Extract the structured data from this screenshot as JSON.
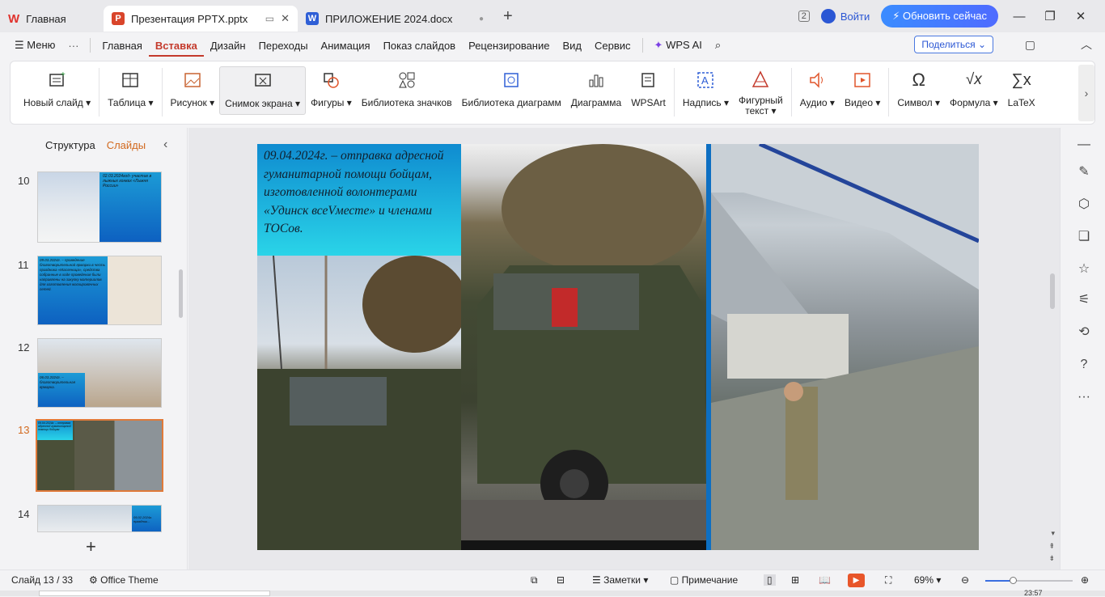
{
  "tabs": {
    "home": "Главная",
    "presentation": "Презентация PPTX.pptx",
    "document": "ПРИЛОЖЕНИЕ 2024.docx"
  },
  "topbar": {
    "login": "Войти",
    "update": "Обновить сейчас",
    "page_badge": "2"
  },
  "menu": {
    "menu_label": "Меню",
    "items": [
      "Главная",
      "Вставка",
      "Дизайн",
      "Переходы",
      "Анимация",
      "Показ слайдов",
      "Рецензирование",
      "Вид",
      "Сервис"
    ],
    "active": "Вставка",
    "wps_ai": "WPS AI",
    "share": "Поделиться"
  },
  "ribbon": {
    "new_slide": "Новый слайд",
    "table": "Таблица",
    "picture": "Рисунок",
    "screenshot": "Снимок экрана",
    "shapes": "Фигуры",
    "icons_lib": "Библиотека значков",
    "charts_lib": "Библиотека диаграмм",
    "chart": "Диаграмма",
    "wpsart": "WPSArt",
    "textbox": "Надпись",
    "wordart_1": "Фигурный",
    "wordart_2": "текст",
    "audio": "Аудио",
    "video": "Видео",
    "symbol": "Символ",
    "formula": "Формула",
    "latex": "LaTeX"
  },
  "panel": {
    "tab_outline": "Структура",
    "tab_slides": "Слайды",
    "slides": [
      {
        "num": "10",
        "text": "02.03.2024год- участие в лыжных гонках «Лыжня России»"
      },
      {
        "num": "11",
        "text": "09.03.2024г. – проведение благотворительной ярмарки в честь праздника «Масленица», средства собранные в ходе проведения были направлены на закупку материалов для изготовления маскировочных сетей."
      },
      {
        "num": "12",
        "text": "06.03.2024г. – благотворительная ярмарка."
      },
      {
        "num": "13",
        "text": "09.04.2024г. – отправка адресной гуманитарной помощи бойцам"
      },
      {
        "num": "14",
        "text": "05.02.2024г. праздник..."
      }
    ],
    "selected": "13"
  },
  "slide": {
    "caption": "09.04.2024г. – отправка адресной гуманитарной помощи бойцам, изготовленной волонтерами «Удинск всеVместе» и членами ТОСов."
  },
  "status": {
    "slide_counter": "Слайд 13 / 33",
    "theme": "Office Theme",
    "notes": "Заметки",
    "comment": "Примечание",
    "zoom": "69%",
    "time": "23:57"
  }
}
